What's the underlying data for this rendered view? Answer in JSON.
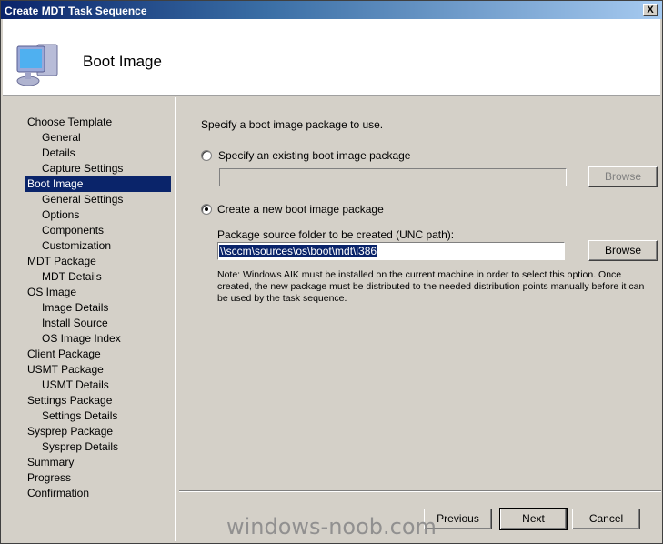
{
  "window": {
    "title": "Create MDT Task Sequence",
    "close_label": "X"
  },
  "header": {
    "title": "Boot Image",
    "icon": "computer-icon"
  },
  "nav": [
    {
      "label": "Choose Template",
      "sub": false
    },
    {
      "label": "General",
      "sub": true
    },
    {
      "label": "Details",
      "sub": true
    },
    {
      "label": "Capture Settings",
      "sub": true
    },
    {
      "label": "Boot Image",
      "sub": false,
      "selected": true
    },
    {
      "label": "General Settings",
      "sub": true
    },
    {
      "label": "Options",
      "sub": true
    },
    {
      "label": "Components",
      "sub": true
    },
    {
      "label": "Customization",
      "sub": true
    },
    {
      "label": "MDT Package",
      "sub": false
    },
    {
      "label": "MDT Details",
      "sub": true
    },
    {
      "label": "OS Image",
      "sub": false
    },
    {
      "label": "Image Details",
      "sub": true
    },
    {
      "label": "Install Source",
      "sub": true
    },
    {
      "label": "OS Image Index",
      "sub": true
    },
    {
      "label": "Client Package",
      "sub": false
    },
    {
      "label": "USMT Package",
      "sub": false
    },
    {
      "label": "USMT Details",
      "sub": true
    },
    {
      "label": "Settings Package",
      "sub": false
    },
    {
      "label": "Settings Details",
      "sub": true
    },
    {
      "label": "Sysprep Package",
      "sub": false
    },
    {
      "label": "Sysprep Details",
      "sub": true
    },
    {
      "label": "Summary",
      "sub": false
    },
    {
      "label": "Progress",
      "sub": false
    },
    {
      "label": "Confirmation",
      "sub": false
    }
  ],
  "main": {
    "prompt": "Specify a boot image package to use.",
    "existing": {
      "label": "Specify an existing boot image package",
      "selected": false,
      "value": "",
      "browse": "Browse"
    },
    "create": {
      "label": "Create a new boot image package",
      "selected": true,
      "field_label": "Package source folder to be created (UNC path):",
      "value": "\\\\sccm\\sources\\os\\boot\\mdt\\i386",
      "browse": "Browse"
    },
    "note": [
      "Note: Windows AIK must be installed on the current machine in order to select this option.  Once",
      "created, the new package must be distributed to the needed distribution points manually before it can",
      "be used by the task sequence."
    ]
  },
  "footer": {
    "previous": "Previous",
    "next": "Next",
    "cancel": "Cancel"
  },
  "watermark": "windows-noob.com"
}
